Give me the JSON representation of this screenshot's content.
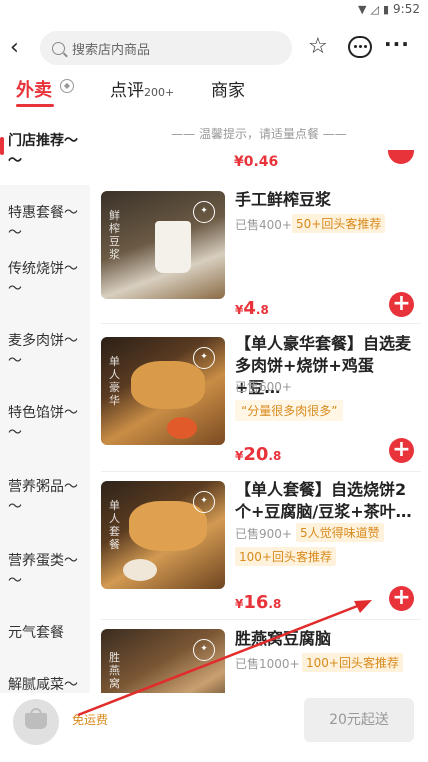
{
  "status_bar": {
    "time": "9:52",
    "wifi_icon": "wifi-icon",
    "signal_icon": "signal-icon",
    "battery_icon": "battery-icon"
  },
  "header": {
    "search_placeholder": "搜索店内商品"
  },
  "tabs": {
    "takeout": "外卖",
    "reviews": "点评",
    "reviews_count": "200+",
    "merchant": "商家"
  },
  "sidebar": {
    "items": [
      {
        "label": "门店推荐～～"
      },
      {
        "label": "特惠套餐～～"
      },
      {
        "label": "传统烧饼～～"
      },
      {
        "label": "麦多肉饼～～"
      },
      {
        "label": "特色馅饼～～"
      },
      {
        "label": "营养粥品～～"
      },
      {
        "label": "营养蛋类～～"
      },
      {
        "label": "元气套餐"
      },
      {
        "label": "解腻咸菜～"
      }
    ]
  },
  "content": {
    "tip": "—— 温馨提示，请适量点餐 ——",
    "partial_price": "¥0.46",
    "items": [
      {
        "name": "手工鲜榨豆浆",
        "sold": "已售400+",
        "tag": "50+回头客推荐",
        "price_currency": "¥",
        "price_int": "4",
        "price_dec": ".8",
        "thumb_text": "鲜榨豆浆"
      },
      {
        "name": "【单人豪华套餐】自选麦多肉饼+烧饼+鸡蛋+豆…",
        "sold": "已售600+",
        "quote": "“分量很多肉很多”",
        "price_currency": "¥",
        "price_int": "20",
        "price_dec": ".8",
        "thumb_text": "单人豪华"
      },
      {
        "name": "【单人套餐】自选烧饼2个+豆腐脑/豆浆+茶叶…",
        "sold": "已售900+",
        "tag": "5人觉得味道赞",
        "tag2": "100+回头客推荐",
        "price_currency": "¥",
        "price_int": "16",
        "price_dec": ".8",
        "thumb_text": "单人套餐"
      },
      {
        "name": "胜燕窝豆腐脑",
        "sold": "已售1000+",
        "tag": "100+回头客推荐",
        "thumb_text": "胜燕窝"
      }
    ]
  },
  "cart": {
    "free_shipping": "免运费",
    "checkout_label": "20元起送"
  },
  "colors": {
    "accent": "#e8333a",
    "tag_text": "#d88a1c",
    "tag_bg": "#fff2dc"
  }
}
